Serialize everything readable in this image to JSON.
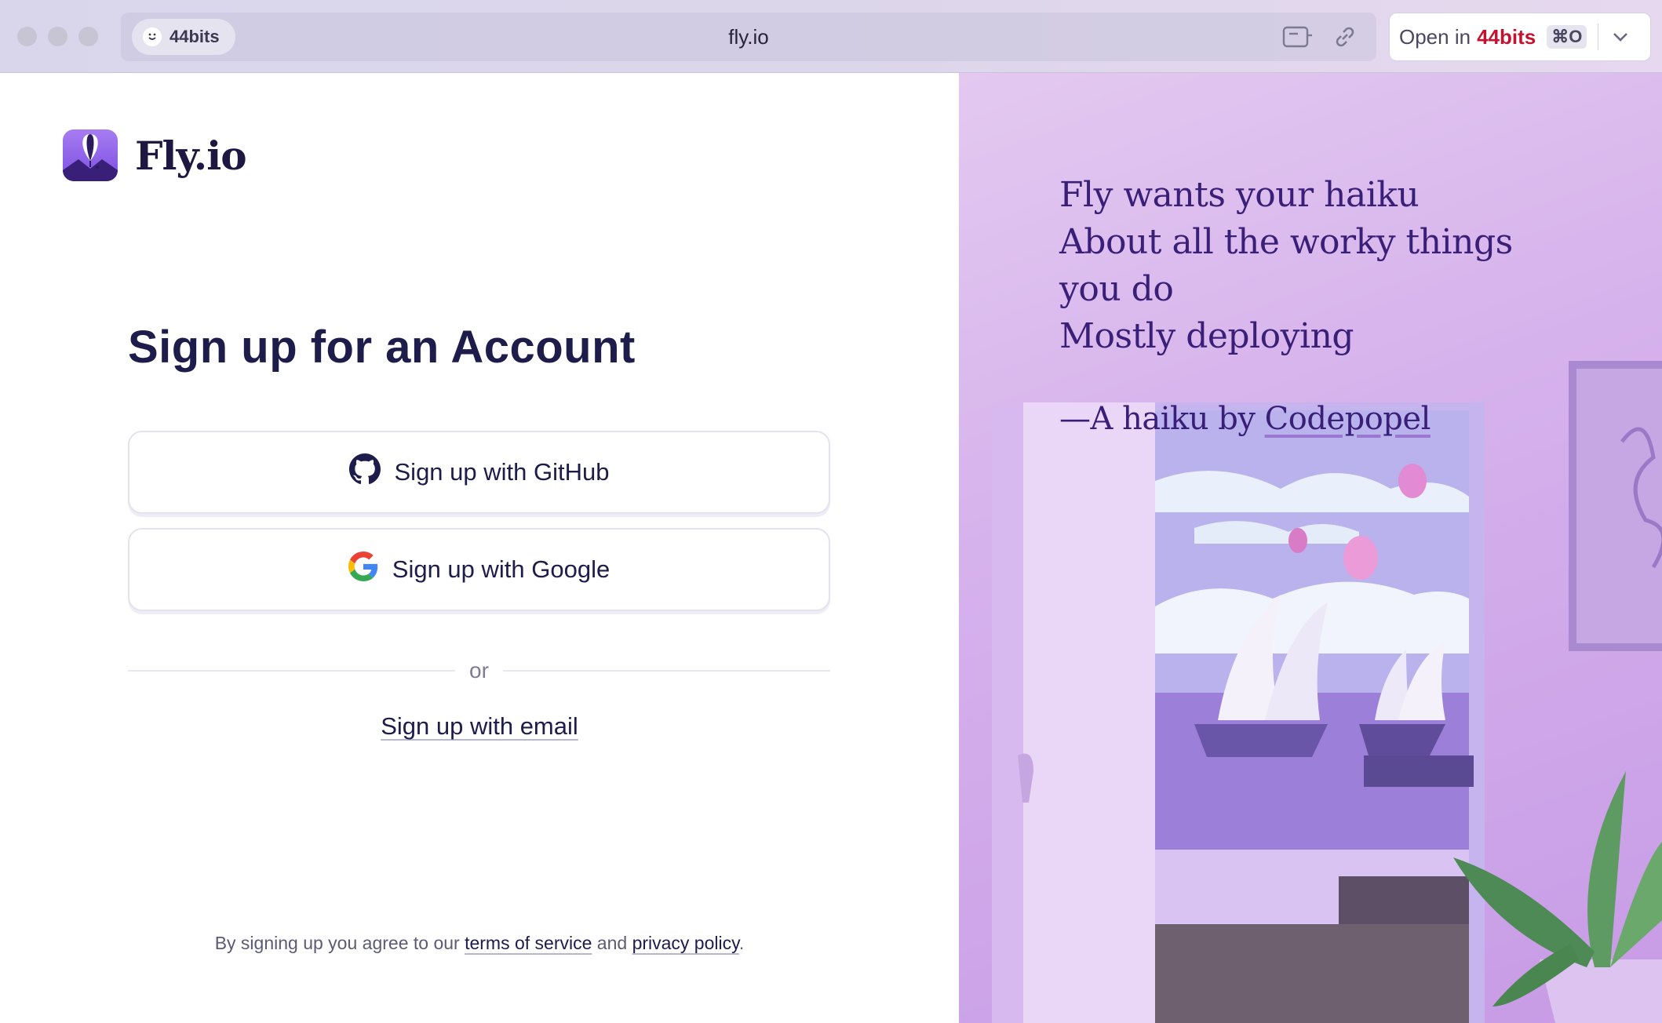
{
  "browser": {
    "profile_label": "44bits",
    "url": "fly.io",
    "open_in": {
      "prefix": "Open in",
      "app": "44bits",
      "shortcut": "⌘O"
    },
    "icons": [
      "smile-icon",
      "reader-icon",
      "link-icon",
      "chevron-down-icon"
    ]
  },
  "brand": {
    "name": "Fly.io"
  },
  "signup": {
    "title": "Sign up for an Account",
    "github_label": "Sign up with GitHub",
    "google_label": "Sign up with Google",
    "divider_label": "or",
    "email_label": "Sign up with email",
    "legal": {
      "prefix": "By signing up you agree to our",
      "terms_label": "terms of service",
      "middle": "and",
      "privacy_label": "privacy policy",
      "suffix": "."
    }
  },
  "haiku": {
    "lines": [
      "Fly wants your haiku",
      "About all the worky things",
      "you do",
      "Mostly deploying"
    ],
    "attribution_prefix": "—A haiku by",
    "author": "Codepopel"
  },
  "colors": {
    "accent": "#c4122f",
    "text_dark": "#1d1c4b",
    "haiku_text": "#3a1f78",
    "illustration_bg": "#d6b2ec"
  }
}
